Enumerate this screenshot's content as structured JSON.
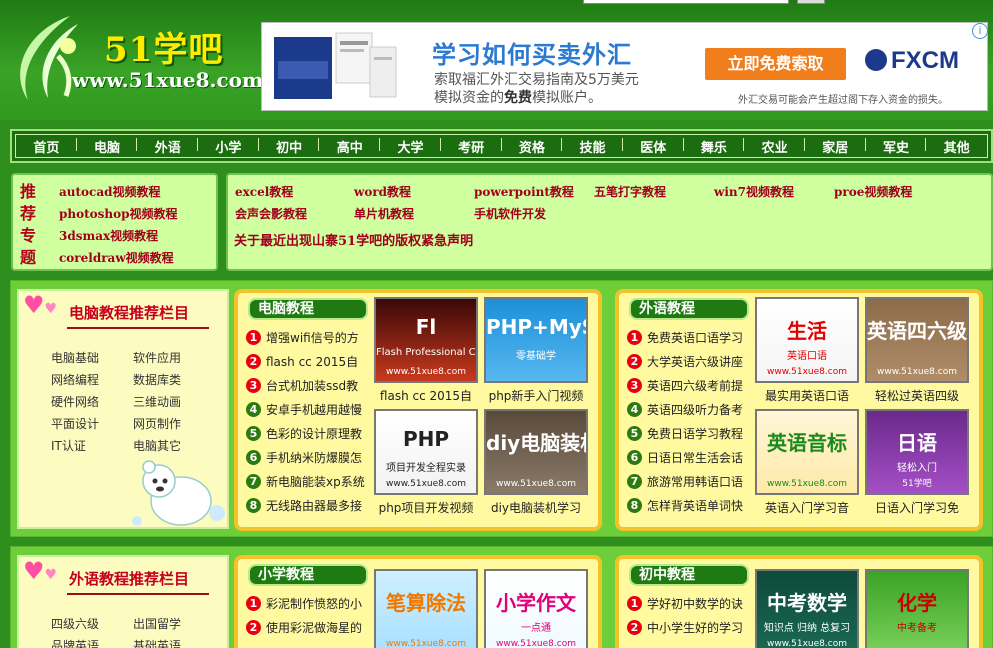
{
  "site": {
    "logo_name": "51学吧",
    "logo_url": "www.51xue8.com"
  },
  "ad": {
    "title": "学习如何买卖外汇",
    "line1": "索取福汇外汇交易指南及5万美元",
    "line2_a": "模拟资金的",
    "line2_b": "免费",
    "line2_c": "模拟账户。",
    "button": "立即免费索取",
    "brand": "FXCM",
    "risk": "外汇交易可能会产生超过阁下存入资金的损失。",
    "info": "i"
  },
  "nav": [
    "首页",
    "电脑",
    "外语",
    "小学",
    "初中",
    "高中",
    "大学",
    "考研",
    "资格",
    "技能",
    "医体",
    "舞乐",
    "农业",
    "家居",
    "军史",
    "其他"
  ],
  "recommend": {
    "label": [
      "推",
      "荐",
      "专",
      "题"
    ],
    "side_links": [
      "autocad视频教程",
      "photoshop视频教程",
      "3dsmax视频教程",
      "coreldraw视频教程"
    ],
    "main_row1": [
      "excel教程",
      "word教程",
      "powerpoint教程",
      "五笔打字教程",
      "win7视频教程",
      "proe视频教程"
    ],
    "main_row2": [
      "会声会影教程",
      "单片机教程",
      "手机软件开发"
    ],
    "notice": "关于最近出现山寨51学吧的版权紧急声明"
  },
  "computer_section": {
    "side_title": "电脑教程推荐栏目",
    "side_items": [
      "电脑基础",
      "软件应用",
      "网络编程",
      "数据库类",
      "硬件网络",
      "三维动画",
      "平面设计",
      "网页制作",
      "IT认证",
      "电脑其它"
    ],
    "panel_computer": {
      "tab": "电脑教程",
      "items": [
        "增强wifi信号的方",
        "flash cc 2015自",
        "台式机加装ssd教",
        "安卓手机越用越慢",
        "色彩的设计原理教",
        "手机纳米防爆膜怎",
        "新电脑能装xp系统",
        "无线路由器最多接"
      ],
      "thumbs": [
        {
          "caption": "flash cc 2015自",
          "img_text": "Fl",
          "img_sub": "Flash Professional CC",
          "img_url": "www.51xue8.com"
        },
        {
          "caption": "php新手入门视频",
          "img_text": "PHP+MySQL",
          "img_sub": "零基础学",
          "img_url": ""
        },
        {
          "caption": "php项目开发视频",
          "img_text": "PHP",
          "img_sub": "项目开发全程实录",
          "img_url": "www.51xue8.com"
        },
        {
          "caption": "diy电脑装机学习",
          "img_text": "diy电脑装机学习视频",
          "img_sub": "",
          "img_url": "www.51xue8.com"
        }
      ]
    },
    "panel_language": {
      "tab": "外语教程",
      "items": [
        "免费英语口语学习",
        "大学英语六级讲座",
        "英语四六级考前提",
        "英语四级听力备考",
        "免费日语学习教程",
        "日语日常生活会话",
        "旅游常用韩语口语",
        "怎样背英语单词快"
      ],
      "thumbs": [
        {
          "caption": "最实用英语口语",
          "img_text": "生活",
          "img_sub": "英语口语",
          "img_url": "www.51xue8.com"
        },
        {
          "caption": "轻松过英语四级",
          "img_text": "英语四六级交流会",
          "img_sub": "",
          "img_url": "www.51xue8.com"
        },
        {
          "caption": "英语入门学习音",
          "img_text": "英语音标",
          "img_sub": "",
          "img_url": "www.51xue8.com"
        },
        {
          "caption": "日语入门学习免",
          "img_text": "日语",
          "img_sub": "轻松入门",
          "img_url": "51学吧"
        }
      ]
    }
  },
  "language_section": {
    "side_title": "外语教程推荐栏目",
    "side_items": [
      "四级六级",
      "出国留学",
      "品牌英语",
      "基础英语"
    ],
    "panel_primary": {
      "tab": "小学教程",
      "items": [
        "彩泥制作愤怒的小",
        "使用彩泥做海星的"
      ],
      "thumbs": [
        {
          "caption": "",
          "img_text": "笔算除法",
          "img_sub": "",
          "img_url": "www.51xue8.com"
        },
        {
          "caption": "",
          "img_text": "小学作文",
          "img_sub": "一点通",
          "img_url": "www.51xue8.com"
        }
      ]
    },
    "panel_junior": {
      "tab": "初中教程",
      "items": [
        "学好初中数学的诀",
        "中小学生好的学习"
      ],
      "thumbs": [
        {
          "caption": "",
          "img_text": "中考数学",
          "img_sub": "知识点 归纳 总复习",
          "img_url": "www.51xue8.com"
        },
        {
          "caption": "",
          "img_text": "化学",
          "img_sub": "中考备考",
          "img_url": ""
        }
      ]
    }
  },
  "colors": {
    "link_red": "#a0001b",
    "nav_bg": "#1c6c10",
    "panel_border": "#f4c22b",
    "accent_orange": "#f07e1c"
  }
}
